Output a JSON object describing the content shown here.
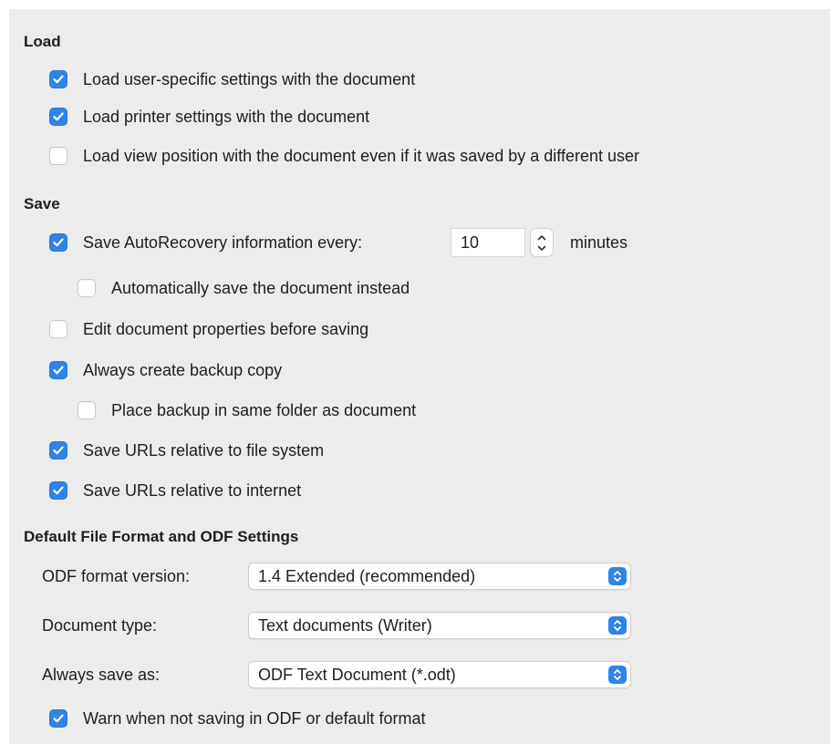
{
  "load": {
    "heading": "Load",
    "options": [
      {
        "label": "Load user-specific settings with the document",
        "checked": true
      },
      {
        "label": "Load printer settings with the document",
        "checked": true
      },
      {
        "label": "Load view position with the document even if it was saved by a different user",
        "checked": false
      }
    ]
  },
  "save": {
    "heading": "Save",
    "autorecovery": {
      "label": "Save AutoRecovery information every:",
      "checked": true,
      "value": "10",
      "unit": "minutes"
    },
    "auto_save": {
      "label": "Automatically save the document instead",
      "checked": false
    },
    "edit_properties": {
      "label": "Edit document properties before saving",
      "checked": false
    },
    "backup": {
      "label": "Always create backup copy",
      "checked": true
    },
    "backup_same_folder": {
      "label": "Place backup in same folder as document",
      "checked": false
    },
    "urls_file_system": {
      "label": "Save URLs relative to file system",
      "checked": true
    },
    "urls_internet": {
      "label": "Save URLs relative to internet",
      "checked": true
    }
  },
  "format": {
    "heading": "Default File Format and ODF Settings",
    "odf_version": {
      "label": "ODF format version:",
      "value": "1.4 Extended (recommended)"
    },
    "document_type": {
      "label": "Document type:",
      "value": "Text documents (Writer)"
    },
    "always_save_as": {
      "label": "Always save as:",
      "value": "ODF Text Document (*.odt)"
    },
    "warn": {
      "label": "Warn when not saving in ODF or default format",
      "checked": true
    }
  },
  "colors": {
    "accent": "#2e84e8",
    "panel": "#ececec",
    "text": "#1e1e1e"
  }
}
